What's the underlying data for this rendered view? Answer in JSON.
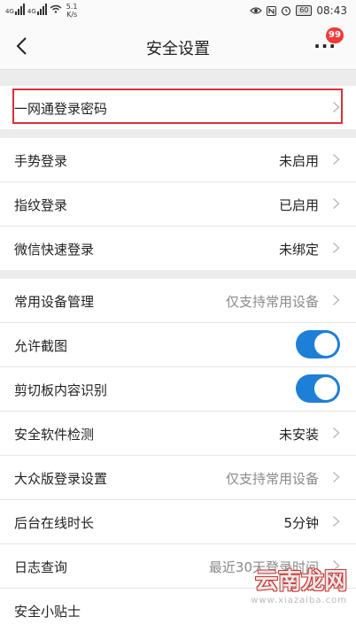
{
  "status_bar": {
    "net1": "4G",
    "net2": "4G",
    "speed_value": "5.1",
    "speed_unit": "K/s",
    "battery": "60",
    "time": "08:43"
  },
  "header": {
    "title": "安全设置",
    "more_label": "···",
    "badge_count": "99"
  },
  "group1": {
    "items": [
      {
        "label": "一网通登录密码"
      }
    ]
  },
  "group2": {
    "items": [
      {
        "label": "手势登录",
        "value": "未启用"
      },
      {
        "label": "指纹登录",
        "value": "已启用"
      },
      {
        "label": "微信快速登录",
        "value": "未绑定"
      }
    ]
  },
  "group3": {
    "items": [
      {
        "label": "常用设备管理",
        "value": "仅支持常用设备"
      },
      {
        "label": "允许截图",
        "toggle_on": true
      },
      {
        "label": "剪切板内容识别",
        "toggle_on": true
      },
      {
        "label": "安全软件检测",
        "value": "未安装"
      },
      {
        "label": "大众版登录设置",
        "value": "仅支持常用设备"
      },
      {
        "label": "后台在线时长",
        "value": "5分钟"
      },
      {
        "label": "日志查询",
        "value": "最近30天登录时间"
      },
      {
        "label": "安全小贴士"
      }
    ]
  },
  "watermark": {
    "text": "云南龙网",
    "url": "www.xiazaiba.com"
  },
  "colors": {
    "toggle_on": "#1e7fd6",
    "highlight_border": "#d9303a",
    "badge": "#f03b3b"
  }
}
